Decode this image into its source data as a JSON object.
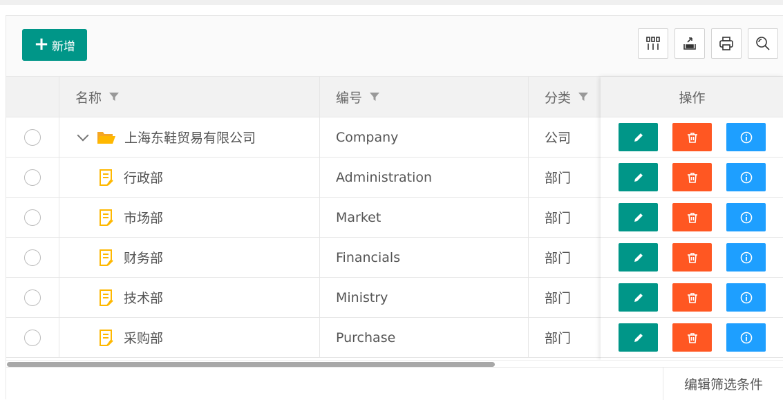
{
  "toolbar": {
    "add_label": "新增",
    "icons": [
      "columns-icon",
      "export-icon",
      "print-icon",
      "search-icon"
    ]
  },
  "table": {
    "columns": {
      "name": "名称",
      "code": "编号",
      "category": "分类",
      "actions": "操作"
    },
    "rows": [
      {
        "name": "上海东鞋贸易有限公司",
        "code": "Company",
        "category": "公司",
        "type": "folder",
        "expanded": true
      },
      {
        "name": "行政部",
        "code": "Administration",
        "category": "部门",
        "type": "file"
      },
      {
        "name": "市场部",
        "code": "Market",
        "category": "部门",
        "type": "file"
      },
      {
        "name": "财务部",
        "code": "Financials",
        "category": "部门",
        "type": "file"
      },
      {
        "name": "技术部",
        "code": "Ministry",
        "category": "部门",
        "type": "file"
      },
      {
        "name": "采购部",
        "code": "Purchase",
        "category": "部门",
        "type": "file"
      }
    ]
  },
  "footer": {
    "filter_label": "编辑筛选条件"
  },
  "colors": {
    "primary": "#009688",
    "danger": "#FF5722",
    "info": "#1E9FFF",
    "folder": "#FFB800"
  }
}
